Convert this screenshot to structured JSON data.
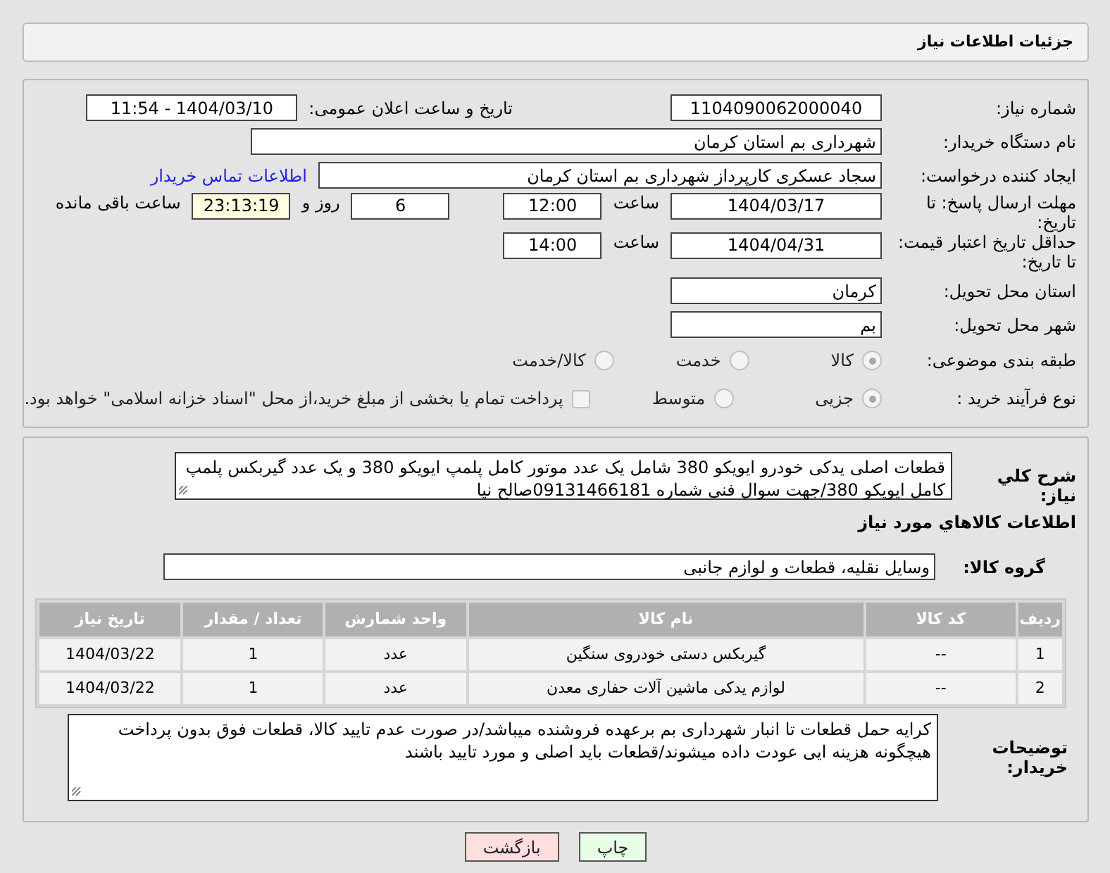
{
  "page_title": "جزئیات اطلاعات نیاز",
  "details": {
    "need_number": {
      "label": "شماره نیاز:",
      "value": "1104090062000040"
    },
    "announce": {
      "label": "تاریخ و ساعت اعلان عمومی:",
      "value": "1404/03/10 - 11:54"
    },
    "buyer": {
      "label": "نام دستگاه خریدار:",
      "value": "شهرداری بم استان کرمان"
    },
    "requester": {
      "label": "ایجاد کننده درخواست:",
      "value": "سجاد عسکری کارپرداز شهرداری بم استان کرمان",
      "link": "اطلاعات تماس خریدار"
    },
    "deadline": {
      "label": "مهلت ارسال پاسخ: تا تاریخ:",
      "date": "1404/03/17",
      "time_label": "ساعت",
      "time": "12:00",
      "days": "6",
      "days_label": "روز و",
      "remaining": "23:13:19",
      "remaining_label": "ساعت باقی مانده"
    },
    "validity": {
      "label": "حداقل تاریخ اعتبار قیمت: تا تاریخ:",
      "date": "1404/04/31",
      "time_label": "ساعت",
      "time": "14:00"
    },
    "province": {
      "label": "استان محل تحویل:",
      "value": "کرمان"
    },
    "city": {
      "label": "شهر محل تحویل:",
      "value": "بم"
    },
    "category": {
      "label": "طبقه بندی موضوعی:",
      "options": [
        {
          "label": "کالا",
          "selected": true
        },
        {
          "label": "خدمت",
          "selected": false
        },
        {
          "label": "کالا/خدمت",
          "selected": false
        }
      ]
    },
    "process": {
      "label": "نوع فرآیند خرید :",
      "options": [
        {
          "label": "جزیی",
          "selected": true
        },
        {
          "label": "متوسط",
          "selected": false
        }
      ],
      "payment_note": {
        "checked": false,
        "text": "پرداخت تمام یا بخشی از مبلغ خرید،از محل \"اسناد خزانه اسلامی\" خواهد بود."
      }
    }
  },
  "description": {
    "label": "شرح کلي نياز:",
    "value": "قطعات اصلی یدکی خودرو ایویکو 380 شامل یک عدد موتور کامل پلمپ ایویکو 380 و یک عدد گیربکس پلمپ کامل ایویکو 380/جهت سوال فنی شماره 09131466181صالح نیا"
  },
  "goods_heading": "اطلاعات كالاهاي مورد نياز",
  "goods_group": {
    "label": "گروه کالا:",
    "value": "وسایل نقلیه، قطعات و لوازم جانبی"
  },
  "table": {
    "columns": [
      "ردیف",
      "کد کالا",
      "نام کالا",
      "واحد شمارش",
      "تعداد / مقدار",
      "تاریخ نیاز"
    ],
    "rows": [
      [
        "1",
        "--",
        "گیربکس دستی خودروی سنگین",
        "عدد",
        "1",
        "1404/03/22"
      ],
      [
        "2",
        "--",
        "لوازم یدکی ماشین آلات حفاری معدن",
        "عدد",
        "1",
        "1404/03/22"
      ]
    ]
  },
  "buyer_notes": {
    "label": "توضیحات خریدار:",
    "value": "کرایه حمل قطعات تا انبار شهرداری بم برعهده فروشنده میباشد/در صورت عدم تایید کالا، قطعات فوق بدون پرداخت هیچگونه هزینه ایی عودت داده میشوند/قطعات باید اصلی و مورد تایید باشند"
  },
  "buttons": [
    {
      "label": "چاپ",
      "kind": "print"
    },
    {
      "label": "بازگشت",
      "kind": "back"
    }
  ]
}
